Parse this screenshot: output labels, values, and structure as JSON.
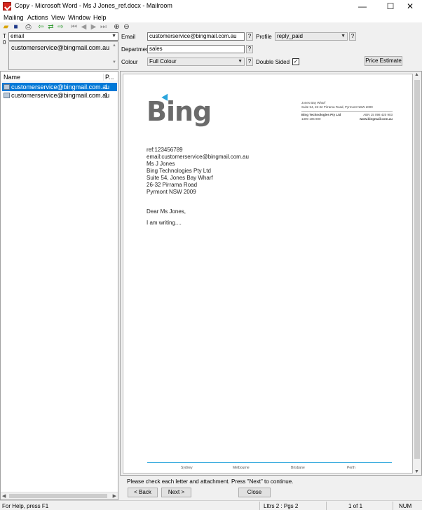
{
  "window": {
    "title": "Copy - Microsoft Word - Ms J Jones_ref.docx - Mailroom",
    "minimize": "—",
    "maximize": "☐",
    "close": "✕"
  },
  "menu": [
    "Mailing",
    "Actions",
    "View",
    "Window",
    "Help"
  ],
  "toolbar": {
    "icons": [
      "open-folder-icon",
      "save-icon",
      "print-icon",
      "back-green-icon",
      "forward-left-green-icon",
      "forward-right-green-icon",
      "first-page-icon",
      "prev-page-icon",
      "next-page-icon",
      "last-page-icon",
      "zoom-in-icon",
      "zoom-out-icon"
    ]
  },
  "recipient": {
    "to_label": "T\n0",
    "type_value": "email",
    "address": "customerservice@bingmail.com.au"
  },
  "form": {
    "email_label": "Email",
    "email_value": "customerservice@bingmail.com.au",
    "department_label": "Department",
    "department_value": "sales",
    "colour_label": "Colour",
    "colour_value": "Full Colour",
    "profile_label": "Profile",
    "profile_value": "reply_paid",
    "double_sided_label": "Double Sided",
    "double_sided_checked": true,
    "help": "?",
    "price_button": "Price Estimate"
  },
  "list": {
    "columns": [
      "Name",
      "P..."
    ],
    "rows": [
      {
        "name": "customerservice@bingmail.com.au",
        "pages": "1",
        "selected": true
      },
      {
        "name": "customerservice@bingmail.com.au",
        "pages": "1",
        "selected": false
      }
    ]
  },
  "letter": {
    "logo": "Bing",
    "company": {
      "street": "Jones Bay Wharf",
      "suite": "Suite 54, 26-32 Pirrama Road, Pyrmont NSW 2009",
      "name": "Bing Technologies Pty Ltd",
      "abn": "ABN 15 098 420 903",
      "phone": "1300 105 800",
      "web": "www.bingmail.com.au"
    },
    "lines": [
      "ref:123456789",
      "email:customerservice@bingmail.com.au",
      "Ms J Jones",
      "Bing Technologies Pty Ltd",
      "Suite 54, Jones Bay Wharf",
      "26-32 Pirrama Road",
      "Pyrmont NSW 2009"
    ],
    "salutation": "Dear Ms Jones,",
    "body": "I am writing....",
    "footer_cities": [
      "Sydney",
      "Melbourne",
      "Brisbane",
      "Perth"
    ]
  },
  "instructions": "Please check each letter and attachment. Press \"Next\" to continue.",
  "buttons": {
    "back": "< Back",
    "next": "Next >",
    "close": "Close"
  },
  "status": {
    "help": "For Help, press F1",
    "letters": "Lttrs 2 : Pgs 2",
    "page": "1 of 1",
    "num": "NUM"
  },
  "colors": {
    "accent": "#0078d7",
    "brand_blue": "#2aa5dc",
    "logo_grey": "#6b6b6b"
  }
}
